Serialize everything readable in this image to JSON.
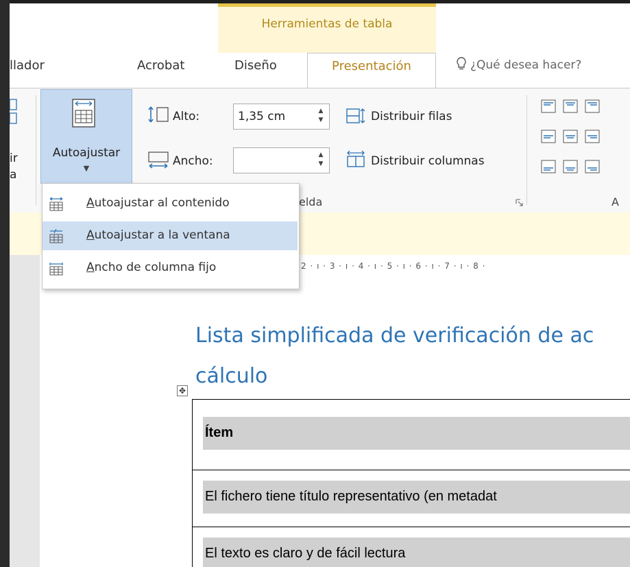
{
  "contextual_group": {
    "label": "Herramientas de tabla"
  },
  "tabs": [
    {
      "label": "llador"
    },
    {
      "label": "Acrobat"
    },
    {
      "label": "Diseño"
    },
    {
      "label": "Presentación",
      "active": true
    }
  ],
  "tell_me": {
    "placeholder": "¿Qué desea hacer?",
    "icon": "lightbulb-icon"
  },
  "ribbon": {
    "partial_left_labels": [
      "ir",
      "a"
    ],
    "autofit": {
      "label": "Autoajustar",
      "icon": "autofit-table-icon"
    },
    "height_label": "Alto:",
    "height_value": "1,35 cm",
    "width_label": "Ancho:",
    "width_value": "",
    "distribute_rows": "Distribuir filas",
    "distribute_cols": "Distribuir columnas",
    "group_cell_size_label": "elda",
    "group_align_label": "A"
  },
  "autofit_menu": {
    "items": [
      {
        "label": "Autoajustar al contenido",
        "underline": "A",
        "icon": "autofit-contents-icon"
      },
      {
        "label": "Autoajustar a la ventana",
        "underline": "A",
        "icon": "autofit-window-icon",
        "highlighted": true
      },
      {
        "label": "Ancho de columna fijo",
        "underline": "A",
        "icon": "fixed-column-width-icon"
      }
    ]
  },
  "ruler": {
    "marks": "2 · ı · 3 · ı · 4 · ı · 5 · ı · 6 · ı · 7 · ı · 8 ·"
  },
  "document": {
    "title_line1": "Lista simplificada de verificación de ac",
    "title_line2": "cálculo",
    "table": {
      "header": "Ítem",
      "rows": [
        "El fichero tiene título representativo (en metadat",
        "El texto es claro y de fácil lectura"
      ]
    }
  },
  "colors": {
    "accent_context": "#e8c549",
    "active_tab_text": "#b5831a",
    "heading_blue": "#2e74b5",
    "menu_highlight": "#cfdff2"
  }
}
